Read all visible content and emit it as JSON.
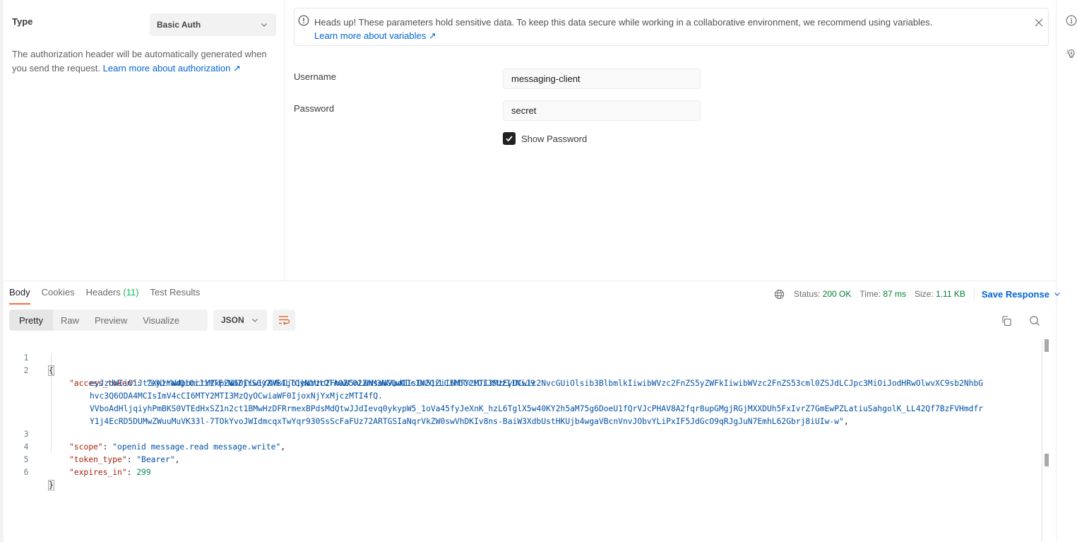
{
  "auth": {
    "type_label": "Type",
    "type_value": "Basic Auth",
    "description": "The authorization header will be automatically generated when you send the request.",
    "learn_more_link": "Learn more about authorization ↗",
    "alert": {
      "text": "Heads up! These parameters hold sensitive data. To keep this data secure while working in a collaborative environment, we recommend using variables.",
      "link": "Learn more about variables ↗"
    },
    "username_label": "Username",
    "username_value": "messaging-client",
    "password_label": "Password",
    "password_value": "secret",
    "show_password_label": "Show Password",
    "show_password_checked": true
  },
  "response": {
    "tabs": [
      {
        "label": "Body",
        "active": true
      },
      {
        "label": "Cookies"
      },
      {
        "label": "Headers",
        "count": "(11)"
      },
      {
        "label": "Test Results"
      }
    ],
    "status_label": "Status:",
    "status_value": "200 OK",
    "time_label": "Time:",
    "time_value": "87 ms",
    "size_label": "Size:",
    "size_value": "1.11 KB",
    "save_response": "Save Response",
    "views": [
      "Pretty",
      "Raw",
      "Preview",
      "Visualize"
    ],
    "active_view": "Pretty",
    "format": "JSON",
    "icons": [
      "globe-icon",
      "wrap-lines-icon",
      "copy-icon",
      "search-icon"
    ]
  },
  "body": {
    "line_numbers": [
      "1",
      "2",
      "3",
      "4",
      "5",
      "6"
    ],
    "open_brace": "{",
    "close_brace": "}",
    "access_token_key": "\"access_token\"",
    "access_token_lines": [
      "\"eyJraWQiOiJiMTFiNWZjYS0yZWE4LTQyNzUtOTA0ZC02ZmM3NGQwODc1N2QiLCJhbGciOiJSUzI1NiJ9.",
      "eyJzdWIiOiJtZXNzYWdpbmctY2xpZW50IiwiYXVkIjoibWVzc2FnaW5nLWNsaWVudCIsIm5iZiI6MTY2MTI3MzEyOCwic2NvcGUiOlsib3BlbmlkIiwibWVzc2FnZS5yZWFkIiwibWVzc2FnZS53cml0ZSJdLCJpc3MiOiJodHRwOlwvXC9sb2NhbG",
      "hvc3Q6ODA4MCIsImV4cCI6MTY2MTI3MzQyOCwiaWF0IjoxNjYxMjczMTI4fQ.",
      "VVboAdHljqiyhPmBKS0VTEdHxSZ1n2ct1BMwHzDFRrmexBPdsMdQtwJJdIevq0ykypW5_1oVa45fyJeXnK_hzL6TglX5w40KY2h5aM75g6DoeU1fQrVJcPHAV8A2fqr8upGMgjRGjMXXDUh5FxIvrZ7GmEwPZLatiuSahgolK_LL42Qf7BzFVHmdfr",
      "Y1j4EcRD5DUMwZWuuMuVK33l-7TOkYvoJWIdmcqxTwYqr930SsScFaFUz72ARTGSIaNqrVkZW0swVhDKIv8ns-BaiW3XdbUstHKUjb4wgaVBcnVnvJObvYLiPxIF5JdGcO9qRJgJuN7EmhL62Gbrj8iUIw-w\""
    ],
    "scope_key": "\"scope\"",
    "scope_value": "\"openid message.read message.write\"",
    "token_type_key": "\"token_type\"",
    "token_type_value": "\"Bearer\"",
    "expires_in_key": "\"expires_in\"",
    "expires_in_value": "299",
    "colon": ": ",
    "comma": ","
  }
}
